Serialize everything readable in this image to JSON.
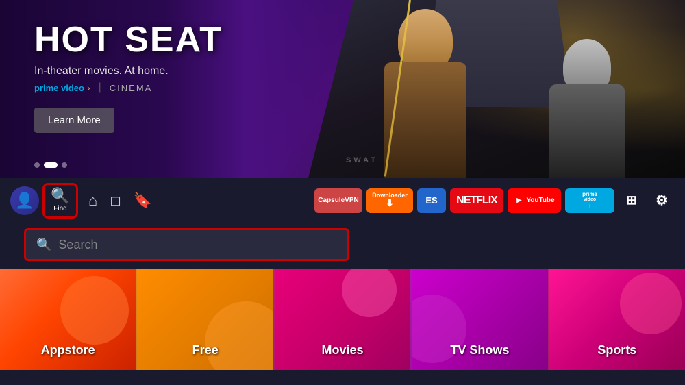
{
  "hero": {
    "title": "HOT SEAT",
    "subtitle": "In-theater movies. At home.",
    "branding_prime": "prime video",
    "branding_separator": "|",
    "branding_cinema": "CINEMA",
    "learn_more": "Learn More",
    "dots": [
      {
        "active": false
      },
      {
        "active": true
      },
      {
        "active": false
      }
    ]
  },
  "nav": {
    "find_label": "Find",
    "icons": {
      "home": "⌂",
      "movies": "⬡",
      "bookmark": "⊟"
    },
    "apps": [
      {
        "id": "capsule",
        "label": "CapsuleVPN",
        "bg": "#cc4444"
      },
      {
        "id": "downloader",
        "label": "Downloader",
        "bg": "#ff6600"
      },
      {
        "id": "es",
        "label": "ES",
        "bg": "#2266cc"
      },
      {
        "id": "netflix",
        "label": "NETFLIX",
        "bg": "#e50914"
      },
      {
        "id": "youtube",
        "label": "YouTube",
        "bg": "#ff0000"
      },
      {
        "id": "prime",
        "label": "prime video",
        "bg": "#00a8e1"
      }
    ]
  },
  "search": {
    "placeholder": "Search"
  },
  "categories": [
    {
      "id": "appstore",
      "label": "Appstore",
      "color_from": "#ff6b35",
      "color_to": "#cc2200"
    },
    {
      "id": "free",
      "label": "Free",
      "color_from": "#ff8c00",
      "color_to": "#cc6e00"
    },
    {
      "id": "movies",
      "label": "Movies",
      "color_from": "#e8007a",
      "color_to": "#a00060"
    },
    {
      "id": "tvshows",
      "label": "TV Shows",
      "color_from": "#cc00cc",
      "color_to": "#880088"
    },
    {
      "id": "sports",
      "label": "Sports",
      "color_from": "#ff1493",
      "color_to": "#990055"
    }
  ]
}
